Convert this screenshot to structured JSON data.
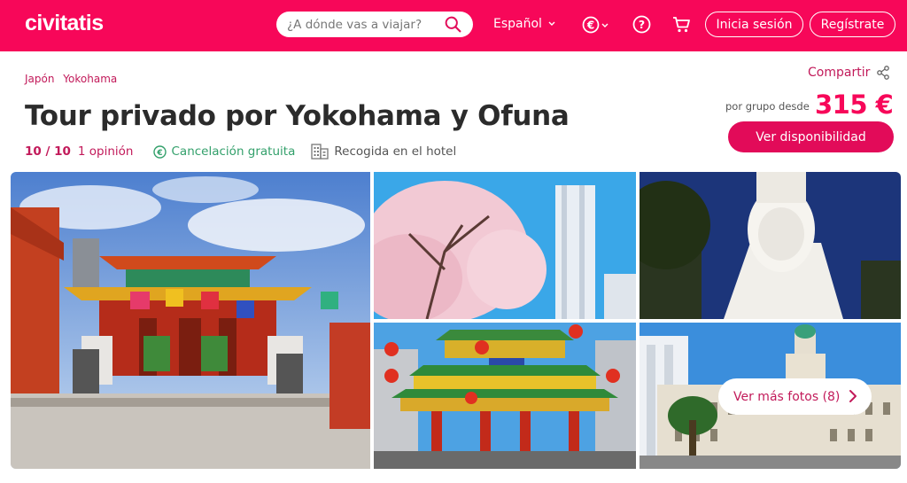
{
  "header": {
    "logo": "civitatis",
    "search_placeholder": "¿A dónde vas a viajar?",
    "language": "Español",
    "login_label": "Inicia sesión",
    "register_label": "Regístrate"
  },
  "breadcrumb": [
    "Japón",
    "Yokohama"
  ],
  "share_label": "Compartir",
  "tour": {
    "title": "Tour privado por Yokohama y Ofuna",
    "rating": "10 / 10",
    "opinions": "1 opinión",
    "cancellation": "Cancelación gratuita",
    "pickup": "Recogida en el hotel"
  },
  "price": {
    "label": "por grupo desde",
    "value": "315 €",
    "button_label": "Ver disponibilidad"
  },
  "gallery": {
    "more_photos_label": "Ver más fotos (8)",
    "photo_count": 5
  },
  "colors": {
    "brand": "#f70759",
    "accent_text": "#c21a5a",
    "green": "#33a06b"
  }
}
